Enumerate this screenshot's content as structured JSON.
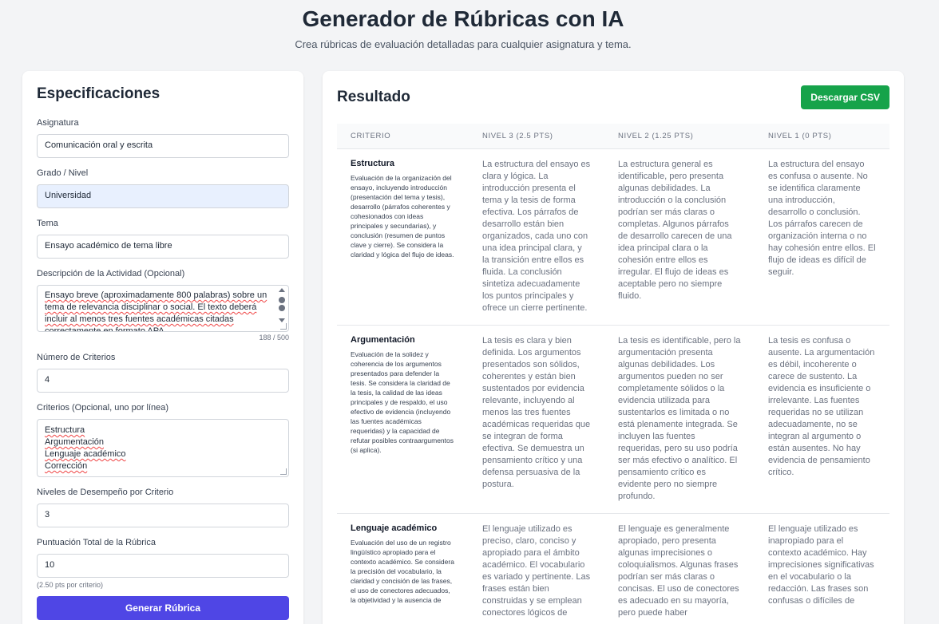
{
  "header": {
    "title": "Generador de Rúbricas con IA",
    "subtitle": "Crea rúbricas de evaluación detalladas para cualquier asignatura y tema."
  },
  "spec": {
    "title": "Especificaciones",
    "asignatura_label": "Asignatura",
    "asignatura_value": "Comunicación oral y escrita",
    "grado_label": "Grado / Nivel",
    "grado_value": "Universidad",
    "tema_label": "Tema",
    "tema_value": "Ensayo académico de tema libre",
    "descripcion_label": "Descripción de la Actividad (Opcional)",
    "descripcion_lines": [
      "Ensayo breve (aproximadamente 800 palabras) sobre un",
      "tema de relevancia disciplinar o social. El texto deberá",
      "incluir al menos tres fuentes académicas citadas",
      "correctamente en formato APA."
    ],
    "descripcion_counter": "188 / 500",
    "num_criterios_label": "Número de Criterios",
    "num_criterios_value": "4",
    "criterios_label": "Criterios (Opcional, uno por línea)",
    "criterios_lines": [
      "Estructura",
      "Argumentación",
      "Lenguaje académico",
      "Corrección"
    ],
    "niveles_label": "Niveles de Desempeño por Criterio",
    "niveles_value": "3",
    "puntuacion_label": "Puntuación Total de la Rúbrica",
    "puntuacion_value": "10",
    "puntuacion_hint": "(2.50 pts por criterio)",
    "generate_label": "Generar Rúbrica"
  },
  "result": {
    "title": "Resultado",
    "download_label": "Descargar CSV",
    "columns": [
      "Criterio",
      "Nivel 3 (2.5 pts)",
      "Nivel 2 (1.25 pts)",
      "Nivel 1 (0 pts)"
    ],
    "rows": [
      {
        "name": "Estructura",
        "description": "Evaluación de la organización del ensayo, incluyendo introducción (presentación del tema y tesis), desarrollo (párrafos coherentes y cohesionados con ideas principales y secundarias), y conclusión (resumen de puntos clave y cierre). Se considera la claridad y lógica del flujo de ideas.",
        "levels": [
          "La estructura del ensayo es clara y lógica. La introducción presenta el tema y la tesis de forma efectiva. Los párrafos de desarrollo están bien organizados, cada uno con una idea principal clara, y la transición entre ellos es fluida. La conclusión sintetiza adecuadamente los puntos principales y ofrece un cierre pertinente.",
          "La estructura general es identificable, pero presenta algunas debilidades. La introducción o la conclusión podrían ser más claras o completas. Algunos párrafos de desarrollo carecen de una idea principal clara o la cohesión entre ellos es irregular. El flujo de ideas es aceptable pero no siempre fluido.",
          "La estructura del ensayo es confusa o ausente. No se identifica claramente una introducción, desarrollo o conclusión. Los párrafos carecen de organización interna o no hay cohesión entre ellos. El flujo de ideas es difícil de seguir."
        ]
      },
      {
        "name": "Argumentación",
        "description": "Evaluación de la solidez y coherencia de los argumentos presentados para defender la tesis. Se considera la claridad de la tesis, la calidad de las ideas principales y de respaldo, el uso efectivo de evidencia (incluyendo las fuentes académicas requeridas) y la capacidad de refutar posibles contraargumentos (si aplica).",
        "levels": [
          "La tesis es clara y bien definida. Los argumentos presentados son sólidos, coherentes y están bien sustentados por evidencia relevante, incluyendo al menos las tres fuentes académicas requeridas que se integran de forma efectiva. Se demuestra un pensamiento crítico y una defensa persuasiva de la postura.",
          "La tesis es identificable, pero la argumentación presenta algunas debilidades. Los argumentos pueden no ser completamente sólidos o la evidencia utilizada para sustentarlos es limitada o no está plenamente integrada. Se incluyen las fuentes requeridas, pero su uso podría ser más efectivo o analítico. El pensamiento crítico es evidente pero no siempre profundo.",
          "La tesis es confusa o ausente. La argumentación es débil, incoherente o carece de sustento. La evidencia es insuficiente o irrelevante. Las fuentes requeridas no se utilizan adecuadamente, no se integran al argumento o están ausentes. No hay evidencia de pensamiento crítico."
        ]
      },
      {
        "name": "Lenguaje académico",
        "description": "Evaluación del uso de un registro lingüístico apropiado para el contexto académico. Se considera la precisión del vocabulario, la claridad y concisión de las frases, el uso de conectores adecuados, la objetividad y la ausencia de",
        "levels": [
          "El lenguaje utilizado es preciso, claro, conciso y apropiado para el ámbito académico. El vocabulario es variado y pertinente. Las frases están bien construidas y se emplean conectores lógicos de",
          "El lenguaje es generalmente apropiado, pero presenta algunas imprecisiones o coloquialismos. Algunas frases podrían ser más claras o concisas. El uso de conectores es adecuado en su mayoría, pero puede haber",
          "El lenguaje utilizado es inapropiado para el contexto académico. Hay imprecisiones significativas en el vocabulario o la redacción. Las frases son confusas o difíciles de"
        ]
      }
    ]
  }
}
